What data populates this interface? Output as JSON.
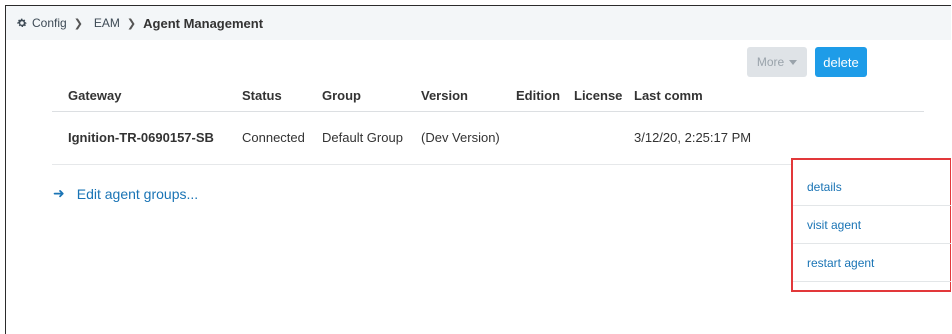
{
  "breadcrumb": {
    "icon": "gear-icon",
    "items": [
      "Config",
      "EAM",
      "Agent Management"
    ]
  },
  "table": {
    "headers": [
      "Gateway",
      "Status",
      "Group",
      "Version",
      "Edition",
      "License",
      "Last comm"
    ],
    "rows": [
      {
        "gateway": "Ignition-TR-0690157-SB",
        "status": "Connected",
        "group": "Default Group",
        "version": "(Dev Version)",
        "edition": "",
        "license": "",
        "last_comm": "3/12/20, 2:25:17 PM",
        "more_label": "More",
        "delete_label": "delete"
      }
    ]
  },
  "edit_link": "Edit agent groups...",
  "dropdown": {
    "items": [
      "details",
      "visit agent",
      "restart agent"
    ],
    "highlight_color": "#e2383a"
  },
  "colors": {
    "link": "#1a74b5",
    "primary_button": "#1e9ce8",
    "header_bar": "#f3f6f8"
  }
}
